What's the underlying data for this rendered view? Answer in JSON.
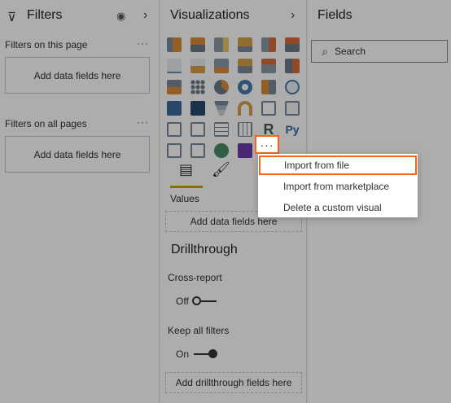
{
  "filters": {
    "title": "Filters",
    "on_this_page_label": "Filters on this page",
    "on_this_page_well": "Add data fields here",
    "all_pages_label": "Filters on all pages",
    "all_pages_well": "Add data fields here",
    "more": "···"
  },
  "visualizations": {
    "title": "Visualizations",
    "more_button": "···",
    "values_label": "Values",
    "values_well": "Add data fields here",
    "drillthrough_title": "Drillthrough",
    "cross_report_label": "Cross-report",
    "cross_report_state": "Off",
    "keep_filters_label": "Keep all filters",
    "keep_filters_state": "On",
    "drillthrough_well": "Add drillthrough fields here"
  },
  "context_menu": {
    "items": [
      "Import from file",
      "Import from marketplace",
      "Delete a custom visual"
    ]
  },
  "fields": {
    "title": "Fields",
    "search_placeholder": "Search"
  },
  "colors": {
    "highlight": "#f4661b",
    "accent_underline": "#c8a400"
  }
}
